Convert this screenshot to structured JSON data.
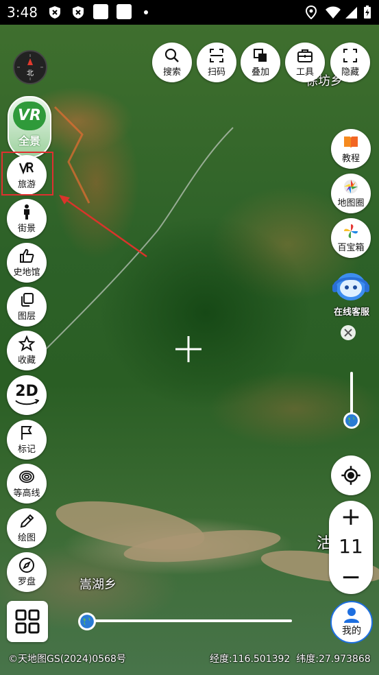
{
  "status_bar": {
    "time": "3:48",
    "left_icons": [
      "shield-x-icon",
      "shield-x-icon",
      "square-icon",
      "square-icon",
      "dot-icon"
    ],
    "right_icons": [
      "location-icon",
      "wifi-icon",
      "signal-icon",
      "battery-charging-icon"
    ]
  },
  "map": {
    "place_labels": [
      "徐坊乡",
      "嵩湖乡",
      "沽"
    ]
  },
  "compass": {
    "label": "北"
  },
  "vr_panorama": {
    "line1": "VR",
    "line2": "全景"
  },
  "top_toolbar": [
    {
      "label": "搜索",
      "icon": "search-icon"
    },
    {
      "label": "扫码",
      "icon": "scan-icon"
    },
    {
      "label": "叠加",
      "icon": "overlay-icon"
    },
    {
      "label": "工具",
      "icon": "toolbox-icon"
    },
    {
      "label": "隐藏",
      "icon": "hide-icon"
    }
  ],
  "left_toolbar": [
    {
      "label": "旅游",
      "icon": "vr-icon"
    },
    {
      "label": "街景",
      "icon": "person-icon"
    },
    {
      "label": "史地馆",
      "icon": "thumbs-up-icon"
    },
    {
      "label": "图层",
      "icon": "layers-icon"
    },
    {
      "label": "收藏",
      "icon": "star-icon"
    },
    {
      "label": "2D",
      "icon": "rotate-2d-icon"
    },
    {
      "label": "标记",
      "icon": "flag-icon"
    },
    {
      "label": "等高线",
      "icon": "contour-icon"
    },
    {
      "label": "绘图",
      "icon": "pencil-icon"
    },
    {
      "label": "罗盘",
      "icon": "compass-icon"
    }
  ],
  "right_toolbar": [
    {
      "label": "教程",
      "icon": "book-icon"
    },
    {
      "label": "地图圈",
      "icon": "aperture-icon"
    },
    {
      "label": "百宝箱",
      "icon": "pinwheel-icon"
    }
  ],
  "customer_service": {
    "label": "在线客服"
  },
  "zoom": {
    "level": "11",
    "plus": "+",
    "minus": "−"
  },
  "me_button": {
    "label": "我的"
  },
  "footer": {
    "copyright": "©天地图GS(2024)0568号",
    "coordinates": "经度:116.501392  纬度:27.973868"
  },
  "colors": {
    "highlight_box": "#e03030",
    "arrow": "#d9342b",
    "vr_badge_green": "#2f9a3a",
    "me_blue": "#1e6fe0"
  }
}
